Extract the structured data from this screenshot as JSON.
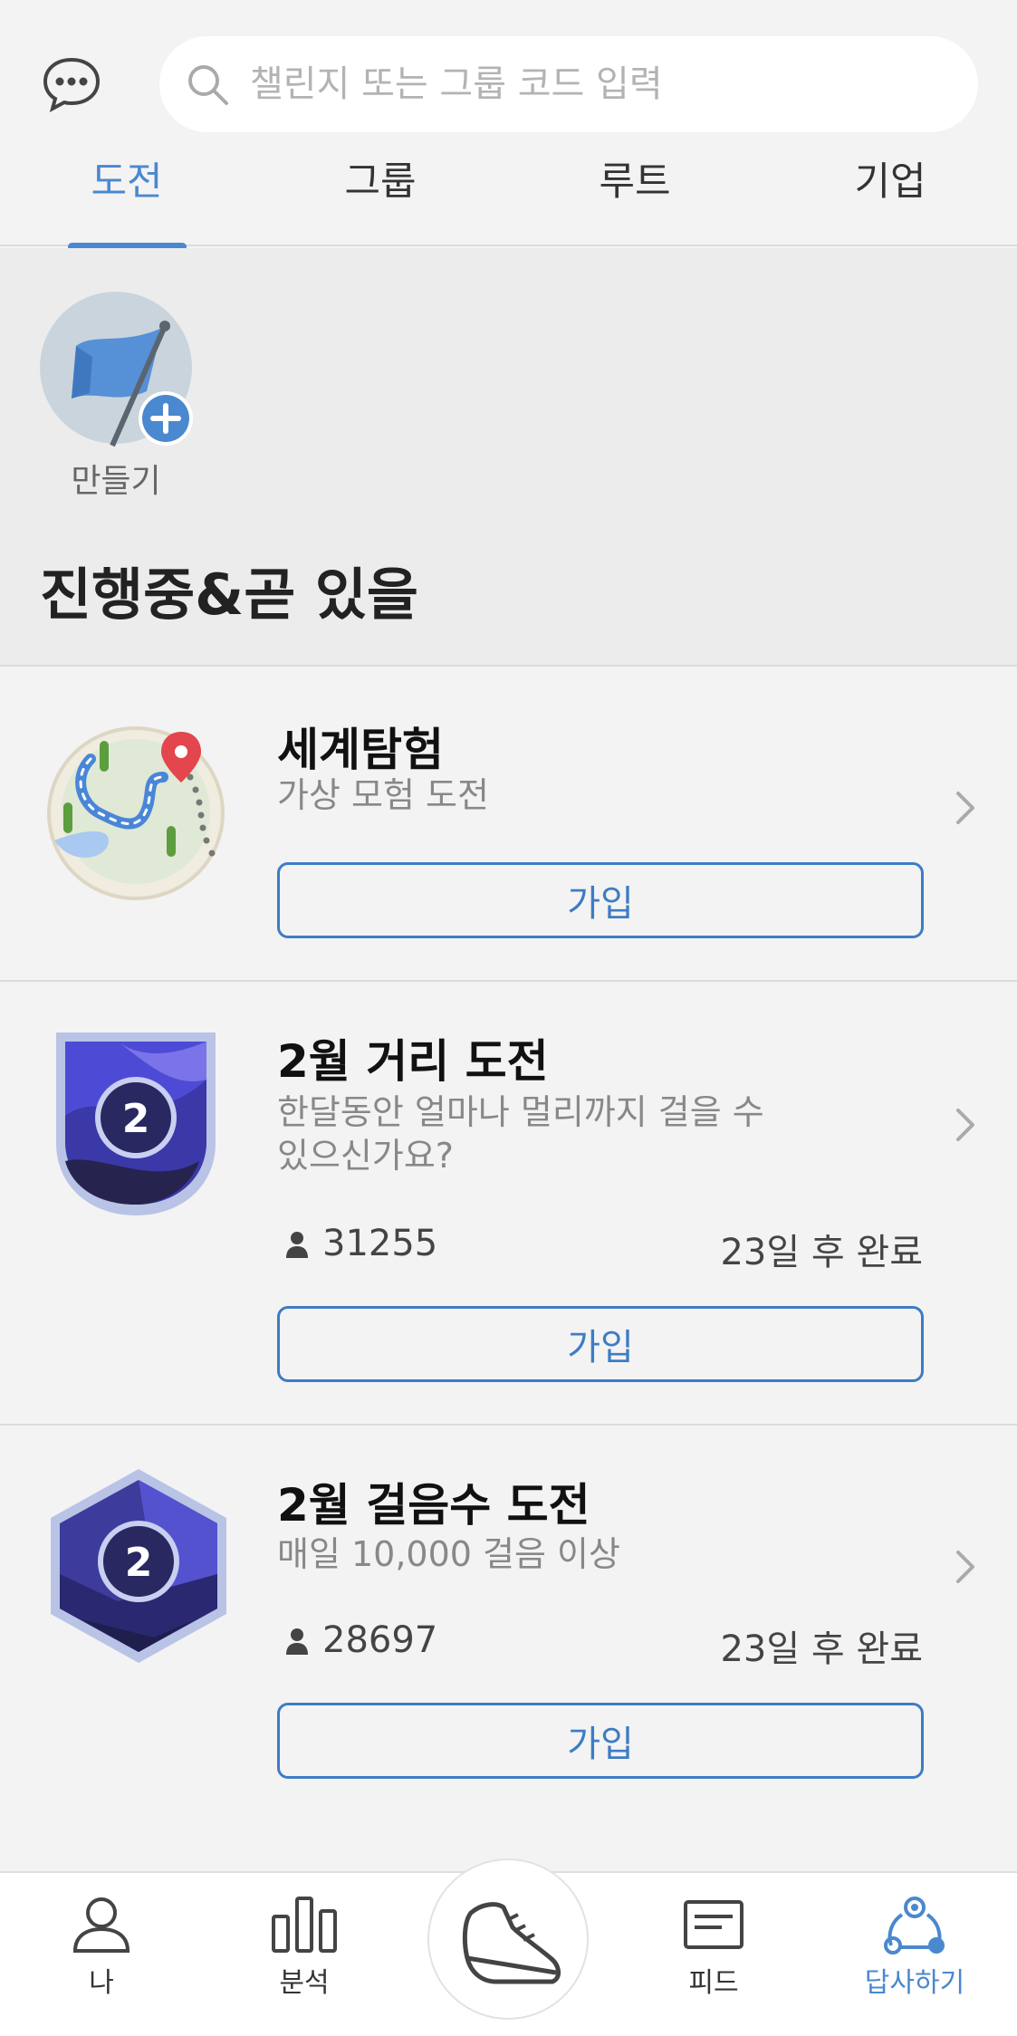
{
  "search": {
    "placeholder": "챌린지 또는 그룹 코드 입력"
  },
  "tabs": [
    {
      "label": "도전"
    },
    {
      "label": "그룹"
    },
    {
      "label": "루트"
    },
    {
      "label": "기업"
    }
  ],
  "create": {
    "label": "만들기"
  },
  "section_title": "진행중&곧 있을",
  "cards": [
    {
      "title": "세계탐험",
      "subtitle": "가상 모험 도전",
      "join_label": "가입"
    },
    {
      "title": "2월 거리 도전",
      "subtitle": "한달동안 얼마나 멀리까지 걸을 수 있으신가요?",
      "badge_number": "2",
      "participants": "31255",
      "remaining": "23일 후 완료",
      "join_label": "가입"
    },
    {
      "title": "2월 걸음수 도전",
      "subtitle": "매일  10,000 걸음 이상",
      "badge_number": "2",
      "participants": "28697",
      "remaining": "23일 후 완료",
      "join_label": "가입"
    }
  ],
  "bottom_nav": [
    {
      "label": "나",
      "icon": "person-icon"
    },
    {
      "label": "분석",
      "icon": "bar-chart-icon"
    },
    {
      "label": "",
      "icon": "shoe-icon"
    },
    {
      "label": "피드",
      "icon": "news-icon"
    },
    {
      "label": "답사하기",
      "icon": "explore-icon"
    }
  ],
  "colors": {
    "accent": "#4a88cf",
    "background": "#f3f3f3"
  }
}
